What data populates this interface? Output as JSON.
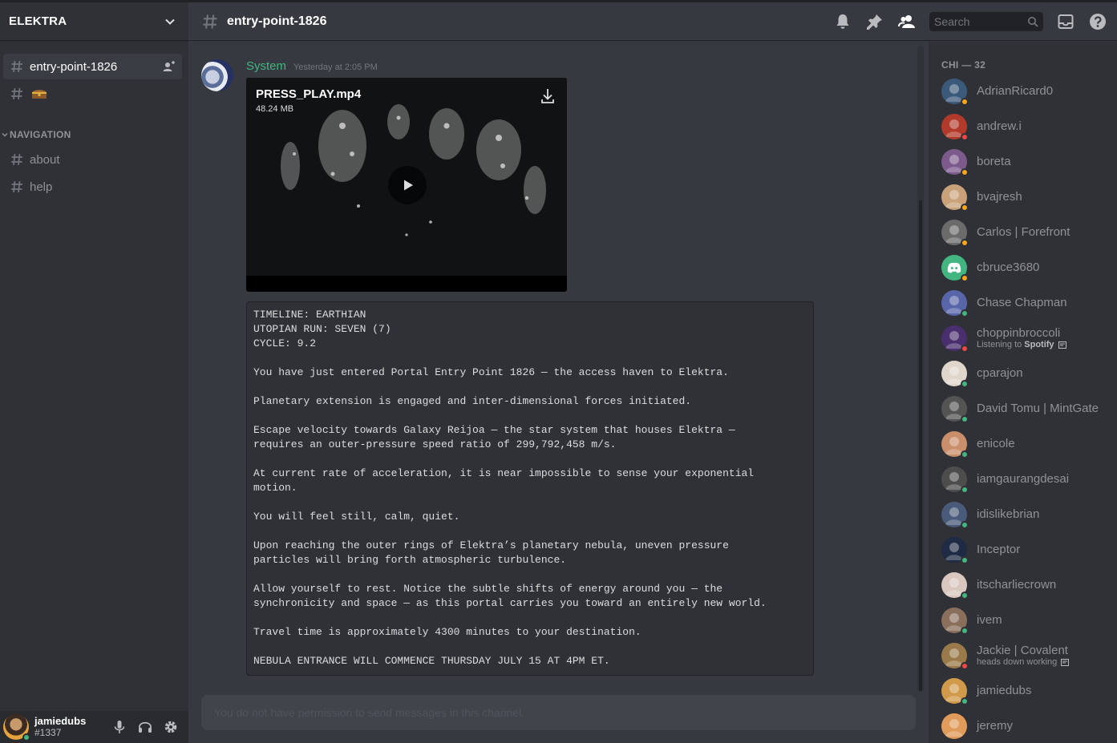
{
  "guild": {
    "name": "ELEKTRA"
  },
  "sidebar": {
    "channels": [
      {
        "name": "entry-point-1826",
        "active": true
      },
      {
        "name": "",
        "icon": "treasure-chest-emoji"
      }
    ],
    "category": "NAVIGATION",
    "nav_channels": [
      {
        "name": "about"
      },
      {
        "name": "help"
      }
    ]
  },
  "user": {
    "name": "jamiedubs",
    "tag": "#1337",
    "status": "online"
  },
  "header": {
    "channel": "entry-point-1826",
    "search_placeholder": "Search"
  },
  "message": {
    "author": "System",
    "timestamp": "Yesterday at 2:05 PM",
    "attachment": {
      "filename": "PRESS_PLAY.mp4",
      "size": "48.24 MB"
    },
    "codeblock": [
      "TIMELINE: EARTHIAN",
      "UTOPIAN RUN: SEVEN (7)",
      "CYCLE: 9.2",
      "",
      "You have just entered Portal Entry Point 1826 — the access haven to Elektra.",
      "",
      "Planetary extension is engaged and inter-dimensional forces initiated.",
      "",
      "Escape velocity towards Galaxy Reijoa — the star system that houses Elektra —",
      "requires an outer-pressure speed ratio of 299,792,458 m/s.",
      "",
      "At current rate of acceleration, it is near impossible to sense your exponential",
      "motion.",
      "",
      "You will feel still, calm, quiet.",
      "",
      "Upon reaching the outer rings of Elektra’s planetary nebula, uneven pressure",
      "particles will bring forth atmospheric turbulence.",
      "",
      "Allow yourself to rest. Notice the subtle shifts of energy around you — the",
      "synchronicity and space — as this portal carries you toward an entirely new world.",
      "",
      "Travel time is approximately 4300 minutes to your destination.",
      "",
      "NEBULA ENTRANCE WILL COMMENCE THURSDAY JULY 15 AT 4PM ET."
    ]
  },
  "input": {
    "placeholder": "You do not have permission to send messages in this channel."
  },
  "members": {
    "heading": "CHI — 32",
    "list": [
      {
        "name": "AdrianRicard0",
        "status": "idle",
        "avatar": "#3b5a7a"
      },
      {
        "name": "andrew.i",
        "status": "dnd",
        "avatar": "#b23a2a"
      },
      {
        "name": "boreta",
        "status": "idle",
        "avatar": "#7d5a8c"
      },
      {
        "name": "bvajresh",
        "status": "idle",
        "avatar": "#c9a27a"
      },
      {
        "name": "Carlos | Forefront",
        "status": "idle",
        "avatar": "#6b6b6b"
      },
      {
        "name": "cbruce3680",
        "status": "idle",
        "avatar": "#43b581",
        "icon": "discord-logo"
      },
      {
        "name": "Chase Chapman",
        "status": "online",
        "avatar": "#5865a8"
      },
      {
        "name": "choppinbroccoli",
        "status": "dnd",
        "avatar": "#4a2f6e",
        "activity_prefix": "Listening to",
        "activity_name": "Spotify"
      },
      {
        "name": "cparajon",
        "status": "online",
        "avatar": "#e0d6cc"
      },
      {
        "name": "David Tomu | MintGate",
        "status": "online",
        "avatar": "#545454"
      },
      {
        "name": "enicole",
        "status": "online",
        "avatar": "#c98e6a"
      },
      {
        "name": "iamgaurangdesai",
        "status": "online",
        "avatar": "#4d4d4d"
      },
      {
        "name": "idislikebrian",
        "status": "online",
        "avatar": "#4a5a7a"
      },
      {
        "name": "Inceptor",
        "status": "online",
        "avatar": "#1f2a44"
      },
      {
        "name": "itscharliecrown",
        "status": "online",
        "avatar": "#d9c7c0"
      },
      {
        "name": "ivem",
        "status": "online",
        "avatar": "#8a6f5c"
      },
      {
        "name": "Jackie | Covalent",
        "status": "dnd",
        "avatar": "#9a7a4a",
        "activity_prefix": "heads down working",
        "activity_name": ""
      },
      {
        "name": "jamiedubs",
        "status": "online",
        "avatar": "#d09a4a"
      },
      {
        "name": "jeremy",
        "status": "",
        "avatar": "#e09a5a"
      }
    ]
  },
  "colors": {
    "accent_green": "#43b581",
    "idle": "#faa61a",
    "dnd": "#f04747",
    "bg": "#36393f"
  }
}
